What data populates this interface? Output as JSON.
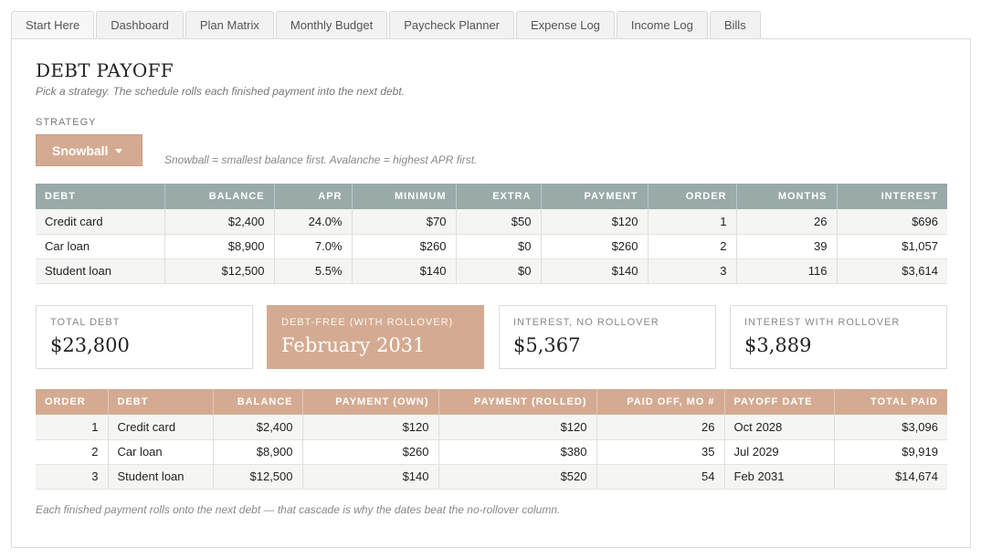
{
  "tabs": [
    "Start Here",
    "Dashboard",
    "Plan Matrix",
    "Monthly Budget",
    "Paycheck Planner",
    "Expense Log",
    "Income Log",
    "Bills"
  ],
  "page": {
    "title": "DEBT PAYOFF",
    "subtitle": "Pick a strategy. The schedule rolls each finished payment into the next debt."
  },
  "strategy": {
    "label": "STRATEGY",
    "selected": "Snowball",
    "note": "Snowball = smallest balance first. Avalanche = highest APR first."
  },
  "debts_table": {
    "headers": [
      "DEBT",
      "BALANCE",
      "APR",
      "MINIMUM",
      "EXTRA",
      "PAYMENT",
      "ORDER",
      "MONTHS",
      "INTEREST"
    ],
    "rows": [
      [
        "Credit card",
        "$2,400",
        "24.0%",
        "$70",
        "$50",
        "$120",
        "1",
        "26",
        "$696"
      ],
      [
        "Car loan",
        "$8,900",
        "7.0%",
        "$260",
        "$0",
        "$260",
        "2",
        "39",
        "$1,057"
      ],
      [
        "Student loan",
        "$12,500",
        "5.5%",
        "$140",
        "$0",
        "$140",
        "3",
        "116",
        "$3,614"
      ]
    ]
  },
  "summary_cards": [
    {
      "label": "TOTAL DEBT",
      "value": "$23,800"
    },
    {
      "label": "DEBT-FREE (WITH ROLLOVER)",
      "value": "February 2031"
    },
    {
      "label": "INTEREST, NO ROLLOVER",
      "value": "$5,367"
    },
    {
      "label": "INTEREST WITH ROLLOVER",
      "value": "$3,889"
    }
  ],
  "schedule_table": {
    "headers": [
      "ORDER",
      "DEBT",
      "BALANCE",
      "PAYMENT (OWN)",
      "PAYMENT (ROLLED)",
      "PAID OFF, MO #",
      "PAYOFF DATE",
      "TOTAL PAID"
    ],
    "rows": [
      [
        "1",
        "Credit card",
        "$2,400",
        "$120",
        "$120",
        "26",
        "Oct 2028",
        "$3,096"
      ],
      [
        "2",
        "Car loan",
        "$8,900",
        "$260",
        "$380",
        "35",
        "Jul 2029",
        "$9,919"
      ],
      [
        "3",
        "Student loan",
        "$12,500",
        "$140",
        "$520",
        "54",
        "Feb 2031",
        "$14,674"
      ]
    ]
  },
  "footnote": "Each finished payment rolls onto the next debt — that cascade is why the dates beat the no-rollover column.",
  "colors": {
    "accent": "#d4ab92",
    "table_header_grey": "#99aaa9"
  }
}
